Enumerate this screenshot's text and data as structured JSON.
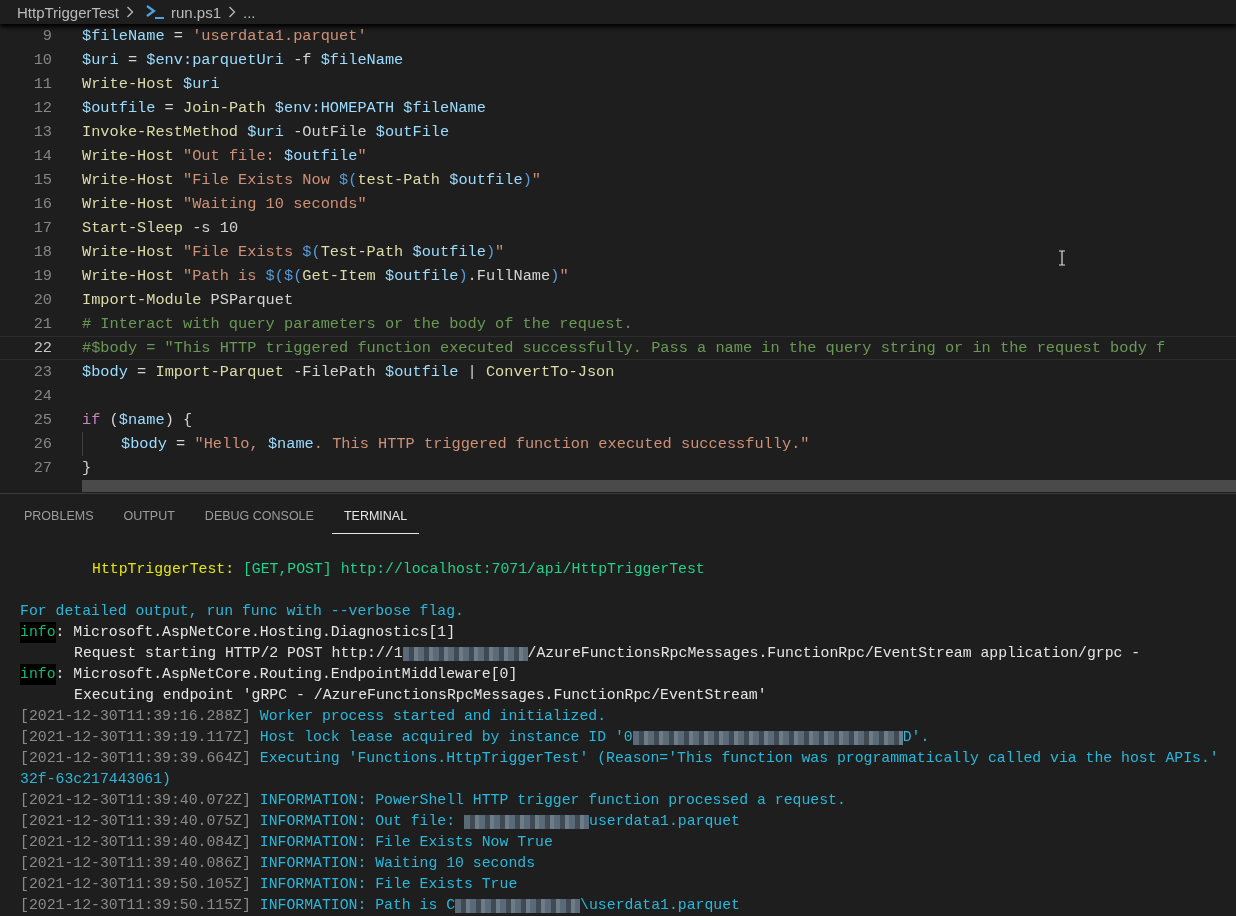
{
  "breadcrumb": [
    {
      "label": "HttpTriggerTest",
      "kind": "folder"
    },
    {
      "label": "run.ps1",
      "kind": "powershell"
    },
    {
      "label": "...",
      "kind": "more"
    }
  ],
  "editor": {
    "lines": [
      {
        "number": "9",
        "current": false,
        "indented": false,
        "tokens": [
          {
            "kind": "var",
            "text": "$fileName"
          },
          {
            "kind": "plain",
            "text": " = "
          },
          {
            "kind": "str",
            "text": "'userdata1.parquet'"
          }
        ]
      },
      {
        "number": "10",
        "current": false,
        "indented": false,
        "tokens": [
          {
            "kind": "var",
            "text": "$uri"
          },
          {
            "kind": "plain",
            "text": " = "
          },
          {
            "kind": "var",
            "text": "$env:parquetUri"
          },
          {
            "kind": "plain",
            "text": " -f "
          },
          {
            "kind": "var",
            "text": "$fileName"
          }
        ]
      },
      {
        "number": "11",
        "current": false,
        "indented": false,
        "tokens": [
          {
            "kind": "cmd",
            "text": "Write-Host "
          },
          {
            "kind": "var",
            "text": "$uri"
          }
        ]
      },
      {
        "number": "12",
        "current": false,
        "indented": false,
        "tokens": [
          {
            "kind": "var",
            "text": "$outfile"
          },
          {
            "kind": "plain",
            "text": " = "
          },
          {
            "kind": "cmd",
            "text": "Join-Path "
          },
          {
            "kind": "var",
            "text": "$env:HOMEPATH $fileName"
          }
        ]
      },
      {
        "number": "13",
        "current": false,
        "indented": false,
        "tokens": [
          {
            "kind": "cmd",
            "text": "Invoke-RestMethod "
          },
          {
            "kind": "var",
            "text": "$uri"
          },
          {
            "kind": "plain",
            "text": " -OutFile "
          },
          {
            "kind": "var",
            "text": "$outFile"
          }
        ]
      },
      {
        "number": "14",
        "current": false,
        "indented": false,
        "tokens": [
          {
            "kind": "cmd",
            "text": "Write-Host "
          },
          {
            "kind": "str",
            "text": "\"Out file: "
          },
          {
            "kind": "var",
            "text": "$outfile"
          },
          {
            "kind": "str",
            "text": "\""
          }
        ]
      },
      {
        "number": "15",
        "current": false,
        "indented": false,
        "tokens": [
          {
            "kind": "cmd",
            "text": "Write-Host "
          },
          {
            "kind": "str",
            "text": "\"File Exists Now "
          },
          {
            "kind": "punc",
            "text": "$("
          },
          {
            "kind": "cmd",
            "text": "test-Path "
          },
          {
            "kind": "var",
            "text": "$outfile"
          },
          {
            "kind": "punc",
            "text": ")"
          },
          {
            "kind": "str",
            "text": "\""
          }
        ]
      },
      {
        "number": "16",
        "current": false,
        "indented": false,
        "tokens": [
          {
            "kind": "cmd",
            "text": "Write-Host "
          },
          {
            "kind": "str",
            "text": "\"Waiting 10 seconds\""
          }
        ]
      },
      {
        "number": "17",
        "current": false,
        "indented": false,
        "tokens": [
          {
            "kind": "cmd",
            "text": "Start-Sleep"
          },
          {
            "kind": "plain",
            "text": " -s 10"
          }
        ]
      },
      {
        "number": "18",
        "current": false,
        "indented": false,
        "tokens": [
          {
            "kind": "cmd",
            "text": "Write-Host "
          },
          {
            "kind": "str",
            "text": "\"File Exists "
          },
          {
            "kind": "punc",
            "text": "$("
          },
          {
            "kind": "cmd",
            "text": "Test-Path "
          },
          {
            "kind": "var",
            "text": "$outfile"
          },
          {
            "kind": "punc",
            "text": ")"
          },
          {
            "kind": "str",
            "text": "\""
          }
        ]
      },
      {
        "number": "19",
        "current": false,
        "indented": false,
        "tokens": [
          {
            "kind": "cmd",
            "text": "Write-Host "
          },
          {
            "kind": "str",
            "text": "\"Path is "
          },
          {
            "kind": "punc",
            "text": "$($("
          },
          {
            "kind": "cmd",
            "text": "Get-Item "
          },
          {
            "kind": "var",
            "text": "$outfile"
          },
          {
            "kind": "punc",
            "text": ")"
          },
          {
            "kind": "plain",
            "text": ".FullName"
          },
          {
            "kind": "punc",
            "text": ")"
          },
          {
            "kind": "str",
            "text": "\""
          }
        ]
      },
      {
        "number": "20",
        "current": false,
        "indented": false,
        "tokens": [
          {
            "kind": "cmd",
            "text": "Import-Module"
          },
          {
            "kind": "plain",
            "text": " PSParquet"
          }
        ]
      },
      {
        "number": "21",
        "current": false,
        "indented": false,
        "tokens": [
          {
            "kind": "cmt",
            "text": "# Interact with query parameters or the body of the request."
          }
        ]
      },
      {
        "number": "22",
        "current": true,
        "indented": false,
        "tokens": [
          {
            "kind": "cmt",
            "text": "#$body = \"This HTTP triggered function executed successfully. Pass a name in the query string or in the request body f"
          }
        ]
      },
      {
        "number": "23",
        "current": false,
        "indented": false,
        "tokens": [
          {
            "kind": "var",
            "text": "$body"
          },
          {
            "kind": "plain",
            "text": " = "
          },
          {
            "kind": "cmd",
            "text": "Import-Parquet"
          },
          {
            "kind": "plain",
            "text": " -FilePath "
          },
          {
            "kind": "var",
            "text": "$outfile"
          },
          {
            "kind": "plain",
            "text": " | "
          },
          {
            "kind": "cmd",
            "text": "ConvertTo-Json"
          }
        ]
      },
      {
        "number": "24",
        "current": false,
        "indented": false
      },
      {
        "number": "25",
        "current": false,
        "indented": false,
        "tokens": [
          {
            "kind": "kw",
            "text": "if"
          },
          {
            "kind": "plain",
            "text": " ("
          },
          {
            "kind": "var",
            "text": "$name"
          },
          {
            "kind": "plain",
            "text": ") {"
          }
        ]
      },
      {
        "number": "26",
        "current": false,
        "indented": true,
        "tokens": [
          {
            "kind": "var",
            "text": "$body"
          },
          {
            "kind": "plain",
            "text": " = "
          },
          {
            "kind": "str",
            "text": "\"Hello, "
          },
          {
            "kind": "var",
            "text": "$name"
          },
          {
            "kind": "str",
            "text": ". This HTTP triggered function executed successfully.\""
          }
        ]
      },
      {
        "number": "27",
        "current": false,
        "indented": false,
        "tokens": [
          {
            "kind": "plain",
            "text": "}"
          }
        ]
      }
    ]
  },
  "panel": {
    "tabs": [
      {
        "label": "PROBLEMS",
        "selected": false
      },
      {
        "label": "OUTPUT",
        "selected": false
      },
      {
        "label": "DEBUG CONSOLE",
        "selected": false
      },
      {
        "label": "TERMINAL",
        "selected": true
      }
    ],
    "terminal": {
      "lines": [
        {
          "kind": "header",
          "segments": [
            {
              "kind": "yellow",
              "text": "HttpTriggerTest:"
            },
            {
              "kind": "green",
              "text": " [GET,POST] http://localhost:7071/api/HttpTriggerTest"
            }
          ]
        },
        {
          "kind": "log",
          "segments": [
            {
              "kind": "cyan",
              "text": "For detailed output, run func with --verbose flag."
            }
          ]
        },
        {
          "kind": "log",
          "segments": [
            {
              "kind": "info",
              "text": "info"
            },
            {
              "kind": "white",
              "text": ": Microsoft.AspNetCore.Hosting.Diagnostics[1]"
            }
          ]
        },
        {
          "kind": "detail",
          "segments": [
            {
              "kind": "white",
              "text": "Request starting HTTP/2 POST http://1"
            },
            {
              "kind": "blur"
            },
            {
              "kind": "white",
              "text": "/AzureFunctionsRpcMessages.FunctionRpc/EventStream application/grpc -"
            }
          ]
        },
        {
          "kind": "log",
          "segments": [
            {
              "kind": "info",
              "text": "info"
            },
            {
              "kind": "white",
              "text": ": Microsoft.AspNetCore.Routing.EndpointMiddleware[0]"
            }
          ]
        },
        {
          "kind": "detail",
          "segments": [
            {
              "kind": "white",
              "text": "Executing endpoint 'gRPC - /AzureFunctionsRpcMessages.FunctionRpc/EventStream'"
            }
          ]
        },
        {
          "kind": "log",
          "segments": [
            {
              "kind": "grey",
              "text": "[2021-12-30T11:39:16.288Z]"
            },
            {
              "kind": "cyan",
              "text": " Worker process started and initialized."
            }
          ]
        },
        {
          "kind": "log",
          "segments": [
            {
              "kind": "grey",
              "text": "[2021-12-30T11:39:19.117Z]"
            },
            {
              "kind": "cyan",
              "text": " Host lock lease acquired by instance ID '0"
            },
            {
              "kind": "blur_wide"
            },
            {
              "kind": "cyan",
              "text": "D'."
            }
          ]
        },
        {
          "kind": "log",
          "segments": [
            {
              "kind": "grey",
              "text": "[2021-12-30T11:39:39.664Z]"
            },
            {
              "kind": "cyan",
              "text": " Executing 'Functions.HttpTriggerTest' (Reason='This function was programmatically called via the host APIs.'"
            }
          ]
        },
        {
          "kind": "log",
          "segments": [
            {
              "kind": "cyan",
              "text": "32f-63c217443061)"
            }
          ]
        },
        {
          "kind": "log",
          "segments": [
            {
              "kind": "grey",
              "text": "[2021-12-30T11:39:40.072Z]"
            },
            {
              "kind": "cyan",
              "text": " INFORMATION: PowerShell HTTP trigger function processed a request."
            }
          ]
        },
        {
          "kind": "log",
          "segments": [
            {
              "kind": "grey",
              "text": "[2021-12-30T11:39:40.075Z]"
            },
            {
              "kind": "cyan",
              "text": " INFORMATION: Out file: "
            },
            {
              "kind": "blur"
            },
            {
              "kind": "cyan",
              "text": "userdata1.parquet"
            }
          ]
        },
        {
          "kind": "log",
          "segments": [
            {
              "kind": "grey",
              "text": "[2021-12-30T11:39:40.084Z]"
            },
            {
              "kind": "cyan",
              "text": " INFORMATION: File Exists Now True"
            }
          ]
        },
        {
          "kind": "log",
          "segments": [
            {
              "kind": "grey",
              "text": "[2021-12-30T11:39:40.086Z]"
            },
            {
              "kind": "cyan",
              "text": " INFORMATION: Waiting 10 seconds"
            }
          ]
        },
        {
          "kind": "log",
          "segments": [
            {
              "kind": "grey",
              "text": "[2021-12-30T11:39:50.105Z]"
            },
            {
              "kind": "cyan",
              "text": " INFORMATION: File Exists True"
            }
          ]
        },
        {
          "kind": "log",
          "segments": [
            {
              "kind": "grey",
              "text": "[2021-12-30T11:39:50.115Z]"
            },
            {
              "kind": "cyan",
              "text": " INFORMATION: Path is C"
            },
            {
              "kind": "blur"
            },
            {
              "kind": "cyan",
              "text": "\\userdata1.parquet"
            }
          ]
        }
      ]
    }
  }
}
